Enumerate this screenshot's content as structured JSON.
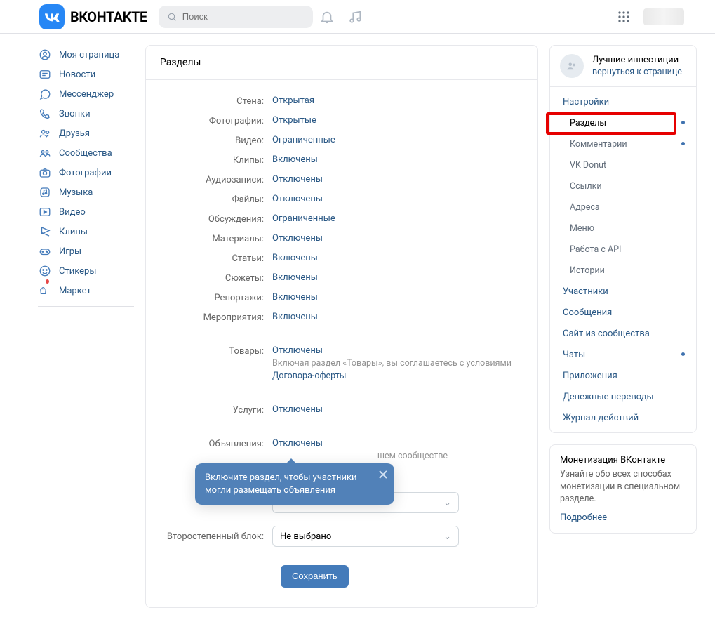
{
  "header": {
    "brand": "ВКОНТАКТЕ",
    "search_placeholder": "Поиск"
  },
  "left_nav": [
    {
      "id": "my-page",
      "label": "Моя страница"
    },
    {
      "id": "news",
      "label": "Новости"
    },
    {
      "id": "messenger",
      "label": "Мессенджер"
    },
    {
      "id": "calls",
      "label": "Звонки"
    },
    {
      "id": "friends",
      "label": "Друзья"
    },
    {
      "id": "communities",
      "label": "Сообщества"
    },
    {
      "id": "photos",
      "label": "Фотографии"
    },
    {
      "id": "music",
      "label": "Музыка"
    },
    {
      "id": "video",
      "label": "Видео"
    },
    {
      "id": "clips",
      "label": "Клипы"
    },
    {
      "id": "games",
      "label": "Игры"
    },
    {
      "id": "stickers",
      "label": "Стикеры"
    },
    {
      "id": "market",
      "label": "Маркет"
    }
  ],
  "main": {
    "title": "Разделы",
    "rows": [
      {
        "label": "Стена:",
        "value": "Открытая"
      },
      {
        "label": "Фотографии:",
        "value": "Открытые"
      },
      {
        "label": "Видео:",
        "value": "Ограниченные"
      },
      {
        "label": "Клипы:",
        "value": "Включены"
      },
      {
        "label": "Аудиозаписи:",
        "value": "Отключены"
      },
      {
        "label": "Файлы:",
        "value": "Отключены"
      },
      {
        "label": "Обсуждения:",
        "value": "Ограниченные"
      },
      {
        "label": "Материалы:",
        "value": "Отключены"
      },
      {
        "label": "Статьи:",
        "value": "Включены"
      },
      {
        "label": "Сюжеты:",
        "value": "Включены"
      },
      {
        "label": "Репортажи:",
        "value": "Включены"
      },
      {
        "label": "Мероприятия:",
        "value": "Включены"
      }
    ],
    "goods": {
      "label": "Товары:",
      "value": "Отключены",
      "sub_pre": "Включая раздел «Товары», вы соглашаетесь с условиями ",
      "sub_link": "Договора-оферты"
    },
    "services": {
      "label": "Услуги:",
      "value": "Отключены"
    },
    "ads": {
      "label": "Объявления:",
      "value": "Отключены",
      "sub_l2": "шем сообществе"
    },
    "main_block": {
      "label": "Главный блок:",
      "value": "Чаты"
    },
    "secondary_block": {
      "label": "Второстепенный блок:",
      "value": "Не выбрано"
    },
    "save": "Сохранить",
    "tip": "Включите раздел, чтобы участники могли размещать объявления"
  },
  "right": {
    "header_title": "Лучшие инвестиции",
    "header_sub": "вернуться к странице",
    "items": [
      {
        "label": "Настройки",
        "sub": false
      },
      {
        "label": "Разделы",
        "sub": true,
        "selected": true,
        "dot": true
      },
      {
        "label": "Комментарии",
        "sub": true,
        "dot": true
      },
      {
        "label": "VK Donut",
        "sub": true
      },
      {
        "label": "Ссылки",
        "sub": true
      },
      {
        "label": "Адреса",
        "sub": true
      },
      {
        "label": "Меню",
        "sub": true
      },
      {
        "label": "Работа с API",
        "sub": true
      },
      {
        "label": "Истории",
        "sub": true
      },
      {
        "label": "Участники",
        "sub": false
      },
      {
        "label": "Сообщения",
        "sub": false
      },
      {
        "label": "Сайт из сообщества",
        "sub": false
      },
      {
        "label": "Чаты",
        "sub": false,
        "dot": true
      },
      {
        "label": "Приложения",
        "sub": false
      },
      {
        "label": "Денежные переводы",
        "sub": false
      },
      {
        "label": "Журнал действий",
        "sub": false
      }
    ],
    "monet": {
      "title": "Монетизация ВКонтакте",
      "desc": "Узнайте обо всех способах монетизации в специальном разделе.",
      "link": "Подробнее"
    }
  }
}
